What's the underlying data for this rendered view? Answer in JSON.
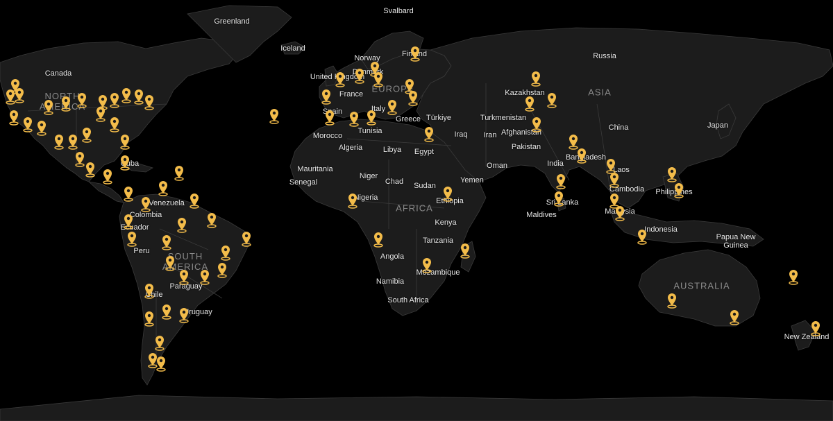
{
  "map": {
    "land_color": "#1c1c1c",
    "border_color": "#3a3a3a",
    "ocean_color": "#000000",
    "marker_color": "#f3bc4a",
    "marker_icon": "map-pin-icon",
    "continent_labels": [
      "NORTH AMERICA",
      "SOUTH AMERICA",
      "EUROPE",
      "AFRICA",
      "ASIA",
      "AUSTRALIA"
    ],
    "place_labels": [
      "Greenland",
      "Svalbard",
      "Iceland",
      "Canada",
      "Finland",
      "Norway",
      "Russia",
      "United Kingdom",
      "Denmark",
      "Spain",
      "France",
      "Italy",
      "Greece",
      "Türkiye",
      "Kazakhstan",
      "Turkmenistan",
      "Afghanistan",
      "Iran",
      "Iraq",
      "Pakistan",
      "China",
      "Japan",
      "Morocco",
      "Tunisia",
      "Algeria",
      "Libya",
      "Egypt",
      "Mauritania",
      "Senegal",
      "Niger",
      "Chad",
      "Sudan",
      "Yemen",
      "Oman",
      "India",
      "Bangladesh",
      "Laos",
      "Cambodia",
      "Philippines",
      "Sri Lanka",
      "Maldives",
      "Malaysia",
      "Indonesia",
      "Papua New Guinea",
      "Nigeria",
      "Ethiopia",
      "Kenya",
      "Tanzania",
      "Angola",
      "Namibia",
      "Mozambique",
      "South Africa",
      "Cuba",
      "Venezuela",
      "Colombia",
      "Ecuador",
      "Peru",
      "Chile",
      "Paraguay",
      "Uruguay",
      "New Zealand"
    ]
  }
}
